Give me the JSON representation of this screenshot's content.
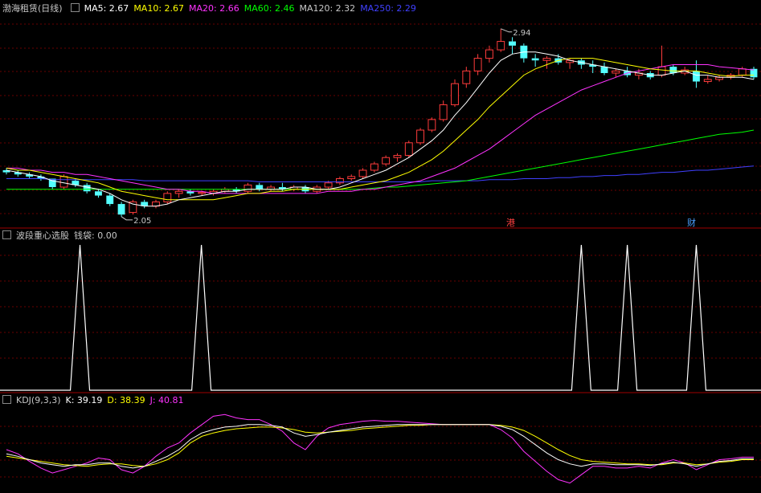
{
  "panels": {
    "main": {
      "title": "渤海租赁(日线)",
      "ma": [
        {
          "label": "MA5: 2.67",
          "color": "#ffffff"
        },
        {
          "label": "MA10: 2.67",
          "color": "#ffff00"
        },
        {
          "label": "MA20: 2.66",
          "color": "#ff33ff"
        },
        {
          "label": "MA60: 2.46",
          "color": "#00ff00"
        },
        {
          "label": "MA120: 2.32",
          "color": "#c8c8c8"
        },
        {
          "label": "MA250: 2.29",
          "color": "#4040ff"
        }
      ],
      "annotations": {
        "high": "2.94",
        "low": "2.05"
      },
      "markers": [
        {
          "text": "港",
          "color": "#ff4040"
        },
        {
          "text": "财",
          "color": "#4aa0ff"
        }
      ]
    },
    "mid": {
      "title": "波段重心选股",
      "value_label": "钱袋: 0.00"
    },
    "kdj": {
      "title": "KDJ(9,3,3)",
      "k": "K: 39.19",
      "d": "D: 38.39",
      "j": "J: 40.81"
    }
  },
  "colors": {
    "up": "#ff3c3c",
    "down": "#54ffff",
    "grid": "#6a0000",
    "border": "#a00000",
    "ma5": "#ffffff",
    "ma10": "#ffff00",
    "ma20": "#ff33ff",
    "ma60": "#00ff00",
    "ma250": "#4040ff",
    "kdj_k": "#ffffff",
    "kdj_d": "#ffff00",
    "kdj_j": "#ff33ff"
  },
  "chart_data": [
    {
      "type": "candlestick",
      "title": "渤海租赁(日线)",
      "ylim": [
        2.0,
        3.0
      ],
      "high_label": 2.94,
      "low_label": 2.05,
      "candles": [
        [
          2.27,
          2.28,
          2.25,
          2.26
        ],
        [
          2.26,
          2.27,
          2.24,
          2.25
        ],
        [
          2.25,
          2.26,
          2.23,
          2.24
        ],
        [
          2.24,
          2.25,
          2.22,
          2.23
        ],
        [
          2.23,
          2.23,
          2.18,
          2.19
        ],
        [
          2.19,
          2.25,
          2.18,
          2.24
        ],
        [
          2.22,
          2.23,
          2.19,
          2.2
        ],
        [
          2.2,
          2.21,
          2.16,
          2.17
        ],
        [
          2.17,
          2.18,
          2.14,
          2.15
        ],
        [
          2.15,
          2.16,
          2.1,
          2.11
        ],
        [
          2.11,
          2.12,
          2.05,
          2.06
        ],
        [
          2.07,
          2.13,
          2.06,
          2.12
        ],
        [
          2.12,
          2.13,
          2.09,
          2.1
        ],
        [
          2.1,
          2.13,
          2.09,
          2.12
        ],
        [
          2.12,
          2.17,
          2.11,
          2.16
        ],
        [
          2.16,
          2.18,
          2.14,
          2.17
        ],
        [
          2.17,
          2.18,
          2.15,
          2.16
        ],
        [
          2.16,
          2.17,
          2.15,
          2.165
        ],
        [
          2.16,
          2.18,
          2.15,
          2.17
        ],
        [
          2.17,
          2.19,
          2.16,
          2.18
        ],
        [
          2.18,
          2.19,
          2.16,
          2.17
        ],
        [
          2.17,
          2.21,
          2.16,
          2.2
        ],
        [
          2.2,
          2.21,
          2.17,
          2.18
        ],
        [
          2.18,
          2.2,
          2.17,
          2.19
        ],
        [
          2.19,
          2.21,
          2.17,
          2.18
        ],
        [
          2.18,
          2.2,
          2.17,
          2.19
        ],
        [
          2.19,
          2.2,
          2.16,
          2.17
        ],
        [
          2.17,
          2.2,
          2.16,
          2.19
        ],
        [
          2.19,
          2.22,
          2.18,
          2.21
        ],
        [
          2.21,
          2.24,
          2.2,
          2.23
        ],
        [
          2.23,
          2.25,
          2.22,
          2.24
        ],
        [
          2.24,
          2.28,
          2.23,
          2.27
        ],
        [
          2.27,
          2.31,
          2.26,
          2.3
        ],
        [
          2.3,
          2.34,
          2.29,
          2.33
        ],
        [
          2.33,
          2.35,
          2.31,
          2.34
        ],
        [
          2.34,
          2.41,
          2.33,
          2.4
        ],
        [
          2.4,
          2.47,
          2.39,
          2.46
        ],
        [
          2.46,
          2.52,
          2.45,
          2.51
        ],
        [
          2.51,
          2.6,
          2.5,
          2.58
        ],
        [
          2.58,
          2.7,
          2.57,
          2.68
        ],
        [
          2.68,
          2.76,
          2.66,
          2.74
        ],
        [
          2.74,
          2.82,
          2.72,
          2.8
        ],
        [
          2.8,
          2.86,
          2.78,
          2.84
        ],
        [
          2.84,
          2.94,
          2.83,
          2.88
        ],
        [
          2.88,
          2.9,
          2.82,
          2.86
        ],
        [
          2.86,
          2.87,
          2.78,
          2.8
        ],
        [
          2.8,
          2.82,
          2.76,
          2.79
        ],
        [
          2.79,
          2.81,
          2.75,
          2.8
        ],
        [
          2.8,
          2.82,
          2.77,
          2.78
        ],
        [
          2.78,
          2.8,
          2.75,
          2.79
        ],
        [
          2.79,
          2.8,
          2.75,
          2.77
        ],
        [
          2.77,
          2.79,
          2.73,
          2.76
        ],
        [
          2.76,
          2.78,
          2.72,
          2.73
        ],
        [
          2.73,
          2.75,
          2.71,
          2.74
        ],
        [
          2.74,
          2.76,
          2.71,
          2.72
        ],
        [
          2.72,
          2.75,
          2.7,
          2.73
        ],
        [
          2.73,
          2.74,
          2.7,
          2.71
        ],
        [
          2.72,
          2.86,
          2.71,
          2.76
        ],
        [
          2.76,
          2.77,
          2.72,
          2.73
        ],
        [
          2.73,
          2.76,
          2.72,
          2.745
        ],
        [
          2.74,
          2.79,
          2.66,
          2.69
        ],
        [
          2.69,
          2.72,
          2.68,
          2.7
        ],
        [
          2.7,
          2.72,
          2.69,
          2.71
        ],
        [
          2.71,
          2.73,
          2.7,
          2.72
        ],
        [
          2.72,
          2.76,
          2.71,
          2.75
        ],
        [
          2.75,
          2.76,
          2.7,
          2.71
        ]
      ],
      "ma5": [
        2.27,
        2.26,
        2.25,
        2.24,
        2.22,
        2.21,
        2.2,
        2.19,
        2.18,
        2.16,
        2.13,
        2.11,
        2.1,
        2.1,
        2.11,
        2.13,
        2.14,
        2.15,
        2.16,
        2.17,
        2.17,
        2.18,
        2.18,
        2.18,
        2.18,
        2.19,
        2.19,
        2.18,
        2.18,
        2.19,
        2.21,
        2.23,
        2.25,
        2.27,
        2.3,
        2.33,
        2.37,
        2.41,
        2.46,
        2.53,
        2.59,
        2.66,
        2.73,
        2.79,
        2.82,
        2.83,
        2.83,
        2.82,
        2.81,
        2.79,
        2.78,
        2.77,
        2.76,
        2.75,
        2.74,
        2.73,
        2.72,
        2.72,
        2.73,
        2.74,
        2.72,
        2.72,
        2.71,
        2.71,
        2.71,
        2.7
      ],
      "ma10": [
        2.28,
        2.27,
        2.27,
        2.26,
        2.25,
        2.24,
        2.23,
        2.22,
        2.21,
        2.19,
        2.17,
        2.16,
        2.15,
        2.14,
        2.13,
        2.13,
        2.13,
        2.13,
        2.13,
        2.14,
        2.15,
        2.16,
        2.16,
        2.17,
        2.17,
        2.18,
        2.18,
        2.18,
        2.18,
        2.18,
        2.19,
        2.2,
        2.21,
        2.22,
        2.24,
        2.26,
        2.29,
        2.32,
        2.36,
        2.41,
        2.46,
        2.51,
        2.57,
        2.62,
        2.67,
        2.72,
        2.75,
        2.77,
        2.79,
        2.8,
        2.8,
        2.8,
        2.79,
        2.78,
        2.77,
        2.76,
        2.75,
        2.745,
        2.74,
        2.74,
        2.74,
        2.73,
        2.72,
        2.715,
        2.72,
        2.72
      ],
      "ma20": [
        2.28,
        2.28,
        2.27,
        2.27,
        2.26,
        2.26,
        2.25,
        2.25,
        2.24,
        2.23,
        2.22,
        2.21,
        2.2,
        2.19,
        2.18,
        2.18,
        2.17,
        2.17,
        2.16,
        2.16,
        2.16,
        2.16,
        2.16,
        2.16,
        2.16,
        2.16,
        2.16,
        2.16,
        2.17,
        2.17,
        2.17,
        2.18,
        2.18,
        2.19,
        2.2,
        2.21,
        2.22,
        2.24,
        2.26,
        2.28,
        2.31,
        2.34,
        2.37,
        2.41,
        2.45,
        2.49,
        2.53,
        2.56,
        2.59,
        2.62,
        2.65,
        2.67,
        2.69,
        2.71,
        2.73,
        2.74,
        2.75,
        2.76,
        2.77,
        2.77,
        2.77,
        2.77,
        2.76,
        2.755,
        2.75,
        2.745
      ],
      "ma60": [
        2.18,
        2.18,
        2.18,
        2.18,
        2.18,
        2.18,
        2.18,
        2.18,
        2.18,
        2.18,
        2.18,
        2.18,
        2.18,
        2.18,
        2.18,
        2.18,
        2.18,
        2.18,
        2.18,
        2.18,
        2.18,
        2.18,
        2.18,
        2.18,
        2.18,
        2.18,
        2.18,
        2.18,
        2.18,
        2.18,
        2.18,
        2.18,
        2.185,
        2.19,
        2.19,
        2.195,
        2.2,
        2.205,
        2.21,
        2.215,
        2.22,
        2.23,
        2.24,
        2.25,
        2.26,
        2.27,
        2.28,
        2.29,
        2.3,
        2.31,
        2.32,
        2.33,
        2.34,
        2.35,
        2.36,
        2.37,
        2.38,
        2.39,
        2.4,
        2.41,
        2.42,
        2.43,
        2.44,
        2.445,
        2.45,
        2.46
      ],
      "ma250": [
        2.23,
        2.23,
        2.23,
        2.23,
        2.225,
        2.225,
        2.225,
        2.225,
        2.225,
        2.225,
        2.225,
        2.225,
        2.22,
        2.22,
        2.22,
        2.22,
        2.22,
        2.22,
        2.22,
        2.22,
        2.22,
        2.22,
        2.215,
        2.215,
        2.215,
        2.215,
        2.215,
        2.215,
        2.215,
        2.215,
        2.215,
        2.215,
        2.215,
        2.215,
        2.215,
        2.215,
        2.215,
        2.22,
        2.22,
        2.22,
        2.22,
        2.22,
        2.225,
        2.225,
        2.225,
        2.23,
        2.23,
        2.23,
        2.235,
        2.235,
        2.24,
        2.24,
        2.245,
        2.245,
        2.25,
        2.25,
        2.255,
        2.26,
        2.26,
        2.265,
        2.27,
        2.27,
        2.275,
        2.28,
        2.285,
        2.29
      ]
    },
    {
      "type": "line",
      "title": "波段重心选股",
      "ylim": [
        0,
        1
      ],
      "spikes_at_bar_index": [
        5,
        15,
        50,
        54,
        60
      ],
      "value": 0.0
    },
    {
      "type": "line",
      "title": "KDJ(9,3,3)",
      "ylim": [
        0,
        100
      ],
      "series": [
        {
          "name": "K",
          "values": [
            45,
            42,
            38,
            34,
            32,
            30,
            32,
            32,
            34,
            34,
            30,
            28,
            30,
            36,
            42,
            50,
            62,
            70,
            74,
            77,
            78,
            80,
            80,
            79,
            77,
            70,
            66,
            68,
            71,
            73,
            75,
            77,
            78,
            79,
            80,
            80,
            80,
            80,
            80,
            80,
            80,
            80,
            80,
            78,
            74,
            66,
            56,
            46,
            38,
            33,
            30,
            33,
            33,
            32,
            32,
            32,
            31,
            33,
            35,
            33,
            30,
            33,
            36,
            37,
            39,
            39
          ]
        },
        {
          "name": "D",
          "values": [
            42,
            40,
            38,
            36,
            34,
            32,
            31,
            30,
            32,
            33,
            33,
            31,
            30,
            33,
            38,
            46,
            58,
            66,
            70,
            73,
            75,
            76,
            77,
            77,
            76,
            74,
            71,
            70,
            71,
            72,
            73,
            75,
            76,
            77,
            78,
            79,
            79,
            80,
            80,
            80,
            80,
            80,
            80,
            79,
            77,
            73,
            66,
            58,
            50,
            43,
            38,
            36,
            35,
            34,
            33,
            33,
            32,
            32,
            34,
            34,
            32,
            33,
            35,
            36,
            38,
            38
          ]
        },
        {
          "name": "J",
          "values": [
            50,
            45,
            36,
            28,
            22,
            26,
            30,
            34,
            40,
            38,
            26,
            22,
            30,
            42,
            52,
            58,
            70,
            80,
            90,
            92,
            88,
            86,
            86,
            80,
            72,
            58,
            50,
            66,
            76,
            80,
            82,
            84,
            85,
            84,
            84,
            83,
            82,
            81,
            80,
            80,
            80,
            80,
            80,
            74,
            64,
            48,
            36,
            24,
            14,
            10,
            20,
            30,
            30,
            28,
            28,
            30,
            28,
            34,
            38,
            34,
            26,
            32,
            38,
            39,
            41,
            41
          ]
        }
      ]
    }
  ]
}
